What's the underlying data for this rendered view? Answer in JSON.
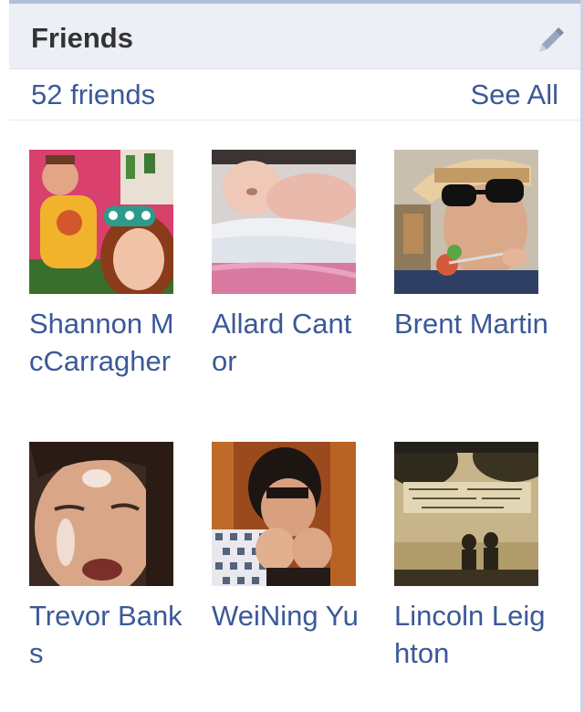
{
  "header": {
    "title": "Friends",
    "edit_icon": "pencil-icon"
  },
  "summary": {
    "count_label": "52 friends",
    "see_all_label": "See All"
  },
  "colors": {
    "link": "#3b5998",
    "header_bg": "#eceff5",
    "title_text": "#333333"
  },
  "friends": [
    {
      "name": "Shannon McCarragher"
    },
    {
      "name": "Allard Cantor"
    },
    {
      "name": "Brent Martin"
    },
    {
      "name": "Trevor Banks"
    },
    {
      "name": "WeiNing Yu"
    },
    {
      "name": "Lincoln Leighton"
    }
  ]
}
